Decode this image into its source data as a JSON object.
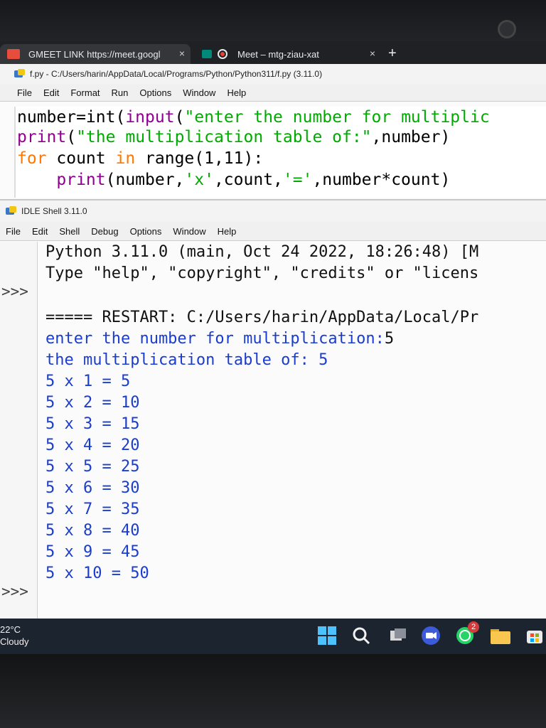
{
  "browser": {
    "tabs": [
      {
        "label": "GMEET LINK https://meet.googl"
      },
      {
        "label": "Meet – mtg-ziau-xat"
      }
    ],
    "close_glyph": "×",
    "new_tab_glyph": "+"
  },
  "editor": {
    "title": "f.py - C:/Users/harin/AppData/Local/Programs/Python/Python311/f.py (3.11.0)",
    "menu": [
      "File",
      "Edit",
      "Format",
      "Run",
      "Options",
      "Window",
      "Help"
    ],
    "code": {
      "l1_a": "number=int(",
      "l1_b": "input",
      "l1_c": "(",
      "l1_d": "\"enter the number for multiplic",
      "l2_a": "print",
      "l2_b": "(",
      "l2_c": "\"the multiplication table of:\"",
      "l2_d": ",number)",
      "l3_a": "for",
      "l3_b": " count ",
      "l3_c": "in",
      "l3_d": " range(1,11):",
      "l4_a": "    print",
      "l4_b": "(number,",
      "l4_c": "'x'",
      "l4_d": ",count,",
      "l4_e": "'='",
      "l4_f": ",number*count)"
    }
  },
  "shell": {
    "title": "IDLE Shell 3.11.0",
    "menu": [
      "File",
      "Edit",
      "Shell",
      "Debug",
      "Options",
      "Window",
      "Help"
    ],
    "banner": [
      "Python 3.11.0 (main, Oct 24 2022, 18:26:48) [M",
      "Type \"help\", \"copyright\", \"credits\" or \"licens"
    ],
    "prompt": ">>>",
    "restart": "===== RESTART: C:/Users/harin/AppData/Local/Pr",
    "input_prompt": "enter the number for multiplication:",
    "input_value": "5",
    "table_header": "the multiplication table of: 5",
    "rows": [
      "5 x 1 = 5",
      "5 x 2 = 10",
      "5 x 3 = 15",
      "5 x 4 = 20",
      "5 x 5 = 25",
      "5 x 6 = 30",
      "5 x 7 = 35",
      "5 x 8 = 40",
      "5 x 9 = 45",
      "5 x 10 = 50"
    ]
  },
  "taskbar": {
    "temperature": "22°C",
    "condition": "Cloudy",
    "whatsapp_badge": "2",
    "icons": [
      "windows-start-icon",
      "search-icon",
      "task-view-icon",
      "meet-icon",
      "whatsapp-icon",
      "file-explorer-icon",
      "store-icon"
    ]
  }
}
